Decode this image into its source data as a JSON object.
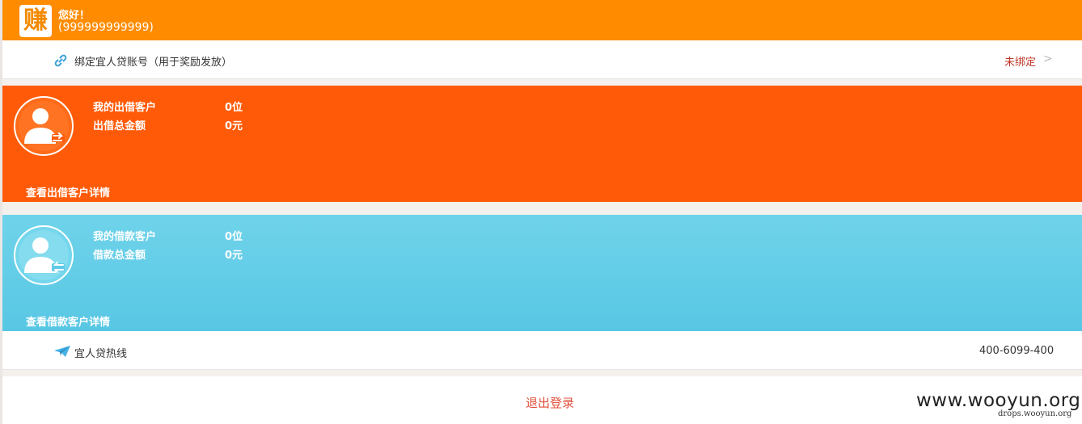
{
  "header": {
    "logo_char": "赚",
    "greeting": "您好！",
    "phone": "(999999999999)",
    "bg_color": "#ff8c00"
  },
  "bind": {
    "icon": "link-icon",
    "label": "绑定宜人贷账号（用于奖励发放）",
    "status": "未绑定",
    "chevron": ">",
    "status_color": "#c0392b"
  },
  "lend_card": {
    "bg_color": "#ff5a07",
    "icon": "user-out-arrow-icon",
    "rows": [
      {
        "label": "我的出借客户",
        "value": "0位"
      },
      {
        "label": "出借总金额",
        "value": "0元"
      }
    ],
    "link": "查看出借客户详情"
  },
  "borrow_card": {
    "bg_color": "#5fcbe6",
    "icon": "user-in-arrow-icon",
    "rows": [
      {
        "label": "我的借款客户",
        "value": "0位"
      },
      {
        "label": "借款总金额",
        "value": "0元"
      }
    ],
    "link": "查看借款客户详情"
  },
  "hotline": {
    "icon": "paper-plane-icon",
    "label": "宜人贷热线",
    "number": "400-6099-400"
  },
  "logout": {
    "label": "退出登录",
    "color": "#e0503b"
  },
  "watermark": {
    "main": "www.wooyun.org",
    "sub": "drops.wooyun.org"
  }
}
